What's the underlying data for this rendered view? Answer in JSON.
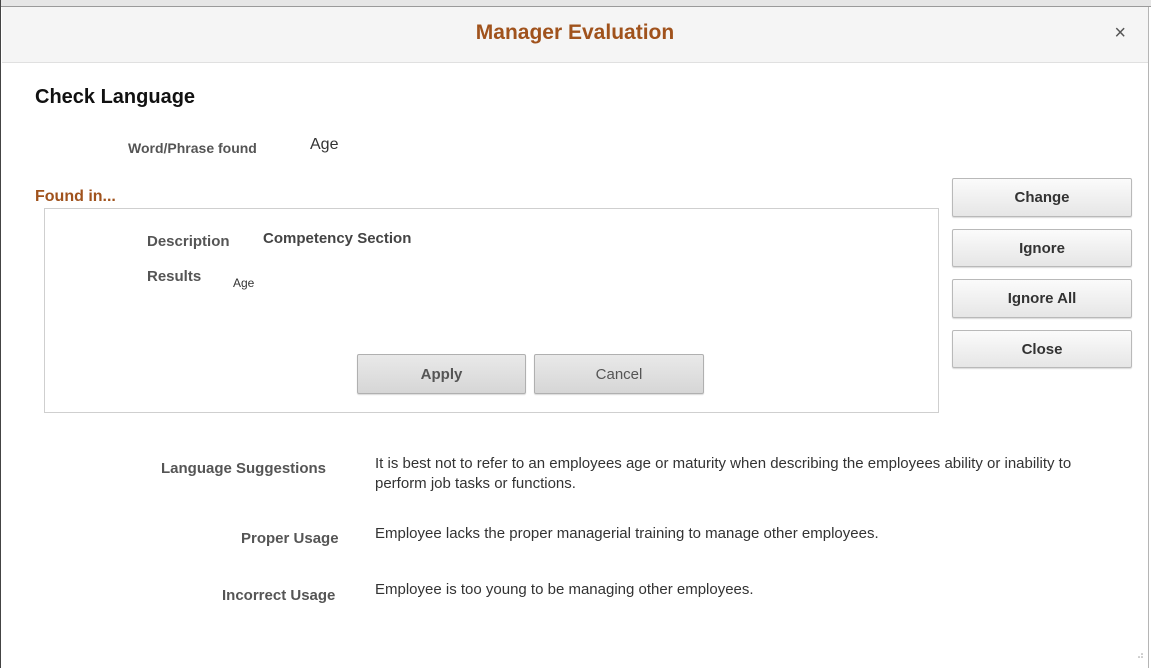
{
  "dialog": {
    "title": "Manager Evaluation",
    "close_icon": "×"
  },
  "page": {
    "title": "Check Language"
  },
  "word_found": {
    "label": "Word/Phrase found",
    "value": "Age"
  },
  "found_in": {
    "heading": "Found in...",
    "description_label": "Description",
    "description_value": "Competency Section",
    "results_label": "Results",
    "results_value": "Age",
    "apply_label": "Apply",
    "cancel_label": "Cancel"
  },
  "actions": {
    "change_label": "Change",
    "ignore_label": "Ignore",
    "ignore_all_label": "Ignore All",
    "close_label": "Close"
  },
  "suggestions": {
    "language_label": "Language Suggestions",
    "language_text": "It is best not to refer to an employees age or maturity when describing the employees ability or inability to perform job tasks or functions.",
    "proper_label": "Proper Usage",
    "proper_text": "Employee lacks the proper managerial training to manage other employees.",
    "incorrect_label": "Incorrect Usage",
    "incorrect_text": "Employee is too young to be managing other employees."
  },
  "colors": {
    "accent": "#a0521c",
    "header_bg": "#f5f5f5"
  }
}
